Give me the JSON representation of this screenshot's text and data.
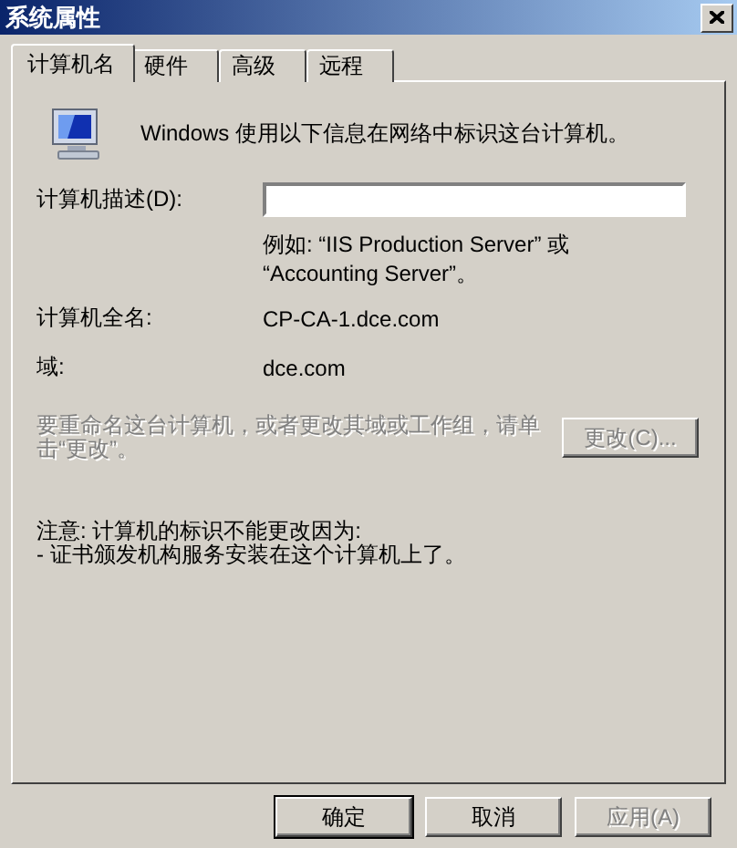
{
  "window": {
    "title": "系统属性"
  },
  "tabs": [
    {
      "label": "计算机名",
      "selected": true
    },
    {
      "label": "硬件",
      "selected": false
    },
    {
      "label": "高级",
      "selected": false
    },
    {
      "label": "远程",
      "selected": false
    }
  ],
  "intro": "Windows 使用以下信息在网络中标识这台计算机。",
  "description_field": {
    "label": "计算机描述(D):",
    "hint": "例如: “IIS Production Server” 或 “Accounting Server”。"
  },
  "info_rows": [
    {
      "label": "计算机全名:",
      "value": "CP-CA-1.dce.com"
    },
    {
      "label": "域:",
      "value": "dce.com"
    }
  ],
  "rename": {
    "text": "要重命名这台计算机，或者更改其域或工作组，请单击“更改”。",
    "disabled": true,
    "button": {
      "label": "更改(C)...",
      "disabled": true
    }
  },
  "note": [
    "注意: 计算机的标识不能更改因为:",
    "- 证书颁发机构服务安装在这个计算机上了。"
  ],
  "buttons": [
    {
      "label": "确定",
      "default": true,
      "disabled": false
    },
    {
      "label": "取消",
      "default": false,
      "disabled": false
    },
    {
      "label": "应用(A)",
      "default": false,
      "disabled": true
    }
  ]
}
